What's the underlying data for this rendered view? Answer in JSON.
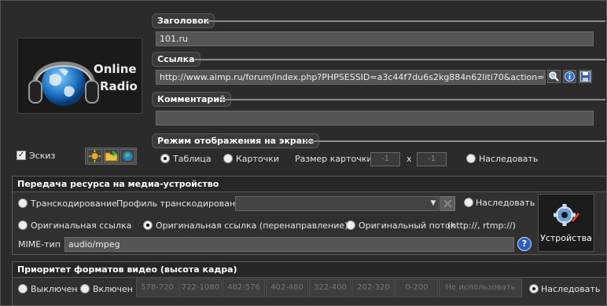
{
  "logo": {
    "line1": "Online",
    "line2": "Radio"
  },
  "title_section": {
    "label": "Заголовок",
    "value": "101.ru"
  },
  "link_section": {
    "label": "Ссылка",
    "value": "http://www.aimp.ru/forum/index.php?PHPSESSID=a3c44f7du6s2kg884n62liti70&action=dlattach;topic"
  },
  "comment_section": {
    "label": "Комментарий",
    "value": ""
  },
  "sketch": {
    "label": "Эскиз",
    "checked": true
  },
  "display_mode": {
    "label": "Режим отображения на экране",
    "option_table": "Таблица",
    "option_cards": "Карточки",
    "card_size_label": "Размер карточки",
    "card_w": "-1",
    "times": "x",
    "card_h": "-1",
    "option_inherit": "Наследовать",
    "selected": "table"
  },
  "transfer": {
    "header": "Передача ресурса на медиа-устройство",
    "transcode": "Транскодирование",
    "profile_label": "Профиль транскодирования",
    "profile_value": "",
    "inherit": "Наследовать",
    "orig_link": "Оригинальная ссылка",
    "orig_link_redirect": "Оригинальная ссылка (перенаправление)",
    "orig_stream": "Оригинальный поток",
    "orig_stream_hint": "(http://, rtmp://)",
    "mime_label": "MIME-тип",
    "mime_value": "audio/mpeg",
    "help": "?",
    "devices_button": "Устройства",
    "selected": "orig_link_redirect"
  },
  "video_priority": {
    "header": "Приоритет форматов видео (высота кадра)",
    "off": "Выключен",
    "on": "Включен",
    "formats": [
      "578-720",
      "722-1080",
      "482-576",
      "402-480",
      "322-400",
      "202-320",
      "0-200",
      "Не использовать"
    ],
    "inherit": "Наследовать",
    "selected": "inherit"
  }
}
